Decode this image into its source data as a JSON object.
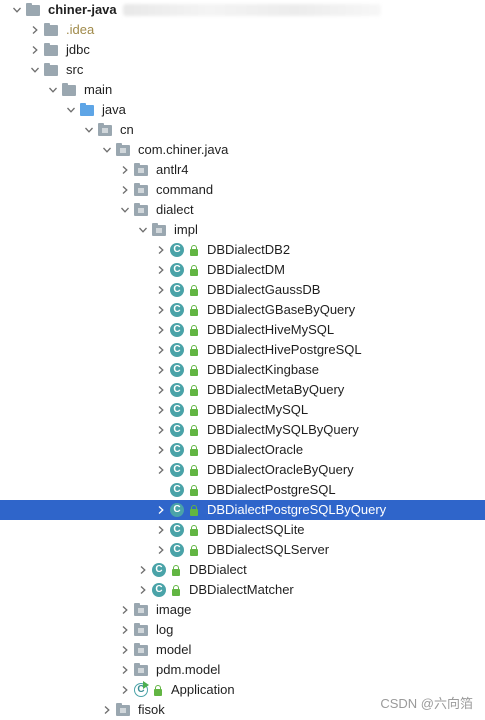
{
  "tree": [
    {
      "label": "chiner-java",
      "depth": 0,
      "type": "folder",
      "state": "open",
      "bold": true,
      "blur_suffix": true
    },
    {
      "label": ".idea",
      "depth": 1,
      "type": "folder",
      "state": "closed",
      "style": "orange"
    },
    {
      "label": "jdbc",
      "depth": 1,
      "type": "folder",
      "state": "closed"
    },
    {
      "label": "src",
      "depth": 1,
      "type": "folder",
      "state": "open"
    },
    {
      "label": "main",
      "depth": 2,
      "type": "folder",
      "state": "open"
    },
    {
      "label": "java",
      "depth": 3,
      "type": "folder-blue",
      "state": "open"
    },
    {
      "label": "cn",
      "depth": 4,
      "type": "package",
      "state": "open"
    },
    {
      "label": "com.chiner.java",
      "depth": 5,
      "type": "package",
      "state": "open"
    },
    {
      "label": "antlr4",
      "depth": 6,
      "type": "package",
      "state": "closed"
    },
    {
      "label": "command",
      "depth": 6,
      "type": "package",
      "state": "closed"
    },
    {
      "label": "dialect",
      "depth": 6,
      "type": "package",
      "state": "open"
    },
    {
      "label": "impl",
      "depth": 7,
      "type": "package",
      "state": "open"
    },
    {
      "label": "DBDialectDB2",
      "depth": 8,
      "type": "class",
      "state": "closed"
    },
    {
      "label": "DBDialectDM",
      "depth": 8,
      "type": "class",
      "state": "closed"
    },
    {
      "label": "DBDialectGaussDB",
      "depth": 8,
      "type": "class",
      "state": "closed"
    },
    {
      "label": "DBDialectGBaseByQuery",
      "depth": 8,
      "type": "class",
      "state": "closed"
    },
    {
      "label": "DBDialectHiveMySQL",
      "depth": 8,
      "type": "class",
      "state": "closed"
    },
    {
      "label": "DBDialectHivePostgreSQL",
      "depth": 8,
      "type": "class",
      "state": "closed"
    },
    {
      "label": "DBDialectKingbase",
      "depth": 8,
      "type": "class",
      "state": "closed"
    },
    {
      "label": "DBDialectMetaByQuery",
      "depth": 8,
      "type": "class",
      "state": "closed"
    },
    {
      "label": "DBDialectMySQL",
      "depth": 8,
      "type": "class",
      "state": "closed"
    },
    {
      "label": "DBDialectMySQLByQuery",
      "depth": 8,
      "type": "class",
      "state": "closed"
    },
    {
      "label": "DBDialectOracle",
      "depth": 8,
      "type": "class",
      "state": "closed"
    },
    {
      "label": "DBDialectOracleByQuery",
      "depth": 8,
      "type": "class",
      "state": "closed"
    },
    {
      "label": "DBDialectPostgreSQL",
      "depth": 8,
      "type": "class",
      "state": "leaf"
    },
    {
      "label": "DBDialectPostgreSQLByQuery",
      "depth": 8,
      "type": "class",
      "state": "closed",
      "selected": true
    },
    {
      "label": "DBDialectSQLite",
      "depth": 8,
      "type": "class",
      "state": "closed"
    },
    {
      "label": "DBDialectSQLServer",
      "depth": 8,
      "type": "class",
      "state": "closed"
    },
    {
      "label": "DBDialect",
      "depth": 7,
      "type": "class",
      "state": "closed"
    },
    {
      "label": "DBDialectMatcher",
      "depth": 7,
      "type": "class",
      "state": "closed"
    },
    {
      "label": "image",
      "depth": 6,
      "type": "package",
      "state": "closed"
    },
    {
      "label": "log",
      "depth": 6,
      "type": "package",
      "state": "closed"
    },
    {
      "label": "model",
      "depth": 6,
      "type": "package",
      "state": "closed"
    },
    {
      "label": "pdm.model",
      "depth": 6,
      "type": "package",
      "state": "closed"
    },
    {
      "label": "Application",
      "depth": 6,
      "type": "main-class",
      "state": "closed"
    },
    {
      "label": "fisok",
      "depth": 5,
      "type": "package",
      "state": "closed"
    }
  ],
  "watermark": "CSDN @六向箔",
  "colors": {
    "selection": "#2f65ca",
    "class_icon": "#4aa3a8",
    "folder": "#9aa7b0",
    "source_folder": "#5ea5e6",
    "lock": "#62b543"
  },
  "icons": {
    "expanded": "chevron-down-icon",
    "collapsed": "chevron-right-icon",
    "class": "class-icon",
    "lock": "lock-icon",
    "folder": "folder-icon",
    "package": "package-icon",
    "run": "run-icon"
  }
}
